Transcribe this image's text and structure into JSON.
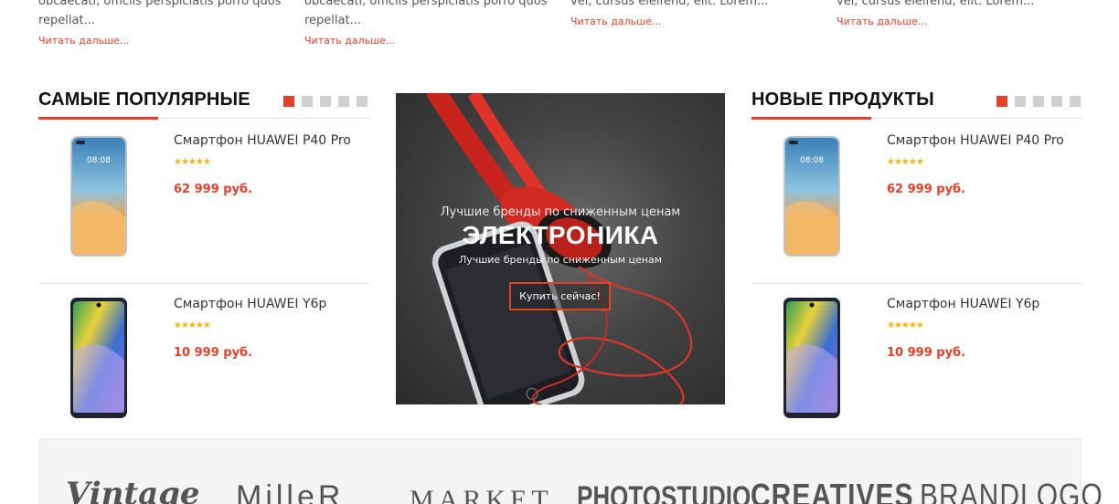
{
  "articles": [
    {
      "excerpt": "obcaecati, officiis perspiciatis porro quos repellat...",
      "more": "Читать дальше..."
    },
    {
      "excerpt": "obcaecati, officiis perspiciatis porro quos repellat...",
      "more": "Читать дальше..."
    },
    {
      "excerpt": "vel, cursus eleifend, elit. Lorem...",
      "more": "Читать дальше..."
    },
    {
      "excerpt": "vel, cursus eleifend, elit. Lorem...",
      "more": "Читать дальше..."
    }
  ],
  "popular": {
    "title": "САМЫЕ ПОПУЛЯРНЫЕ",
    "active_page": 1,
    "pages": 5,
    "products": [
      {
        "name": "Смартфон HUAWEI P40 Pro",
        "rating": 5,
        "stars": "★★★★★",
        "price": "62 999 руб."
      },
      {
        "name": "Смартфон HUAWEI Y6p",
        "rating": 5,
        "stars": "★★★★★",
        "price": "10 999 руб."
      }
    ]
  },
  "banner": {
    "subtitle_top": "Лучшие бренды по сниженным ценам",
    "title": "ЭЛЕКТРОНИКА",
    "subtitle_bottom": "Лучшие бренды по сниженным ценам",
    "button": "Купить сейчас!"
  },
  "new_products": {
    "title": "НОВЫЕ ПРОДУКТЫ",
    "active_page": 1,
    "pages": 5,
    "products": [
      {
        "name": "Смартфон HUAWEI P40 Pro",
        "rating": 5,
        "stars": "★★★★★",
        "price": "62 999 руб."
      },
      {
        "name": "Смартфон HUAWEI Y6p",
        "rating": 5,
        "stars": "★★★★★",
        "price": "10 999 руб."
      }
    ]
  },
  "brands": [
    "Vintage",
    "MilleR",
    "MARKET",
    "PHOTOSTUDIO",
    "CREATIVES",
    "BRANDLOGO"
  ],
  "colors": {
    "accent": "#e2412a",
    "star": "#f5b31b",
    "text": "#333333"
  }
}
